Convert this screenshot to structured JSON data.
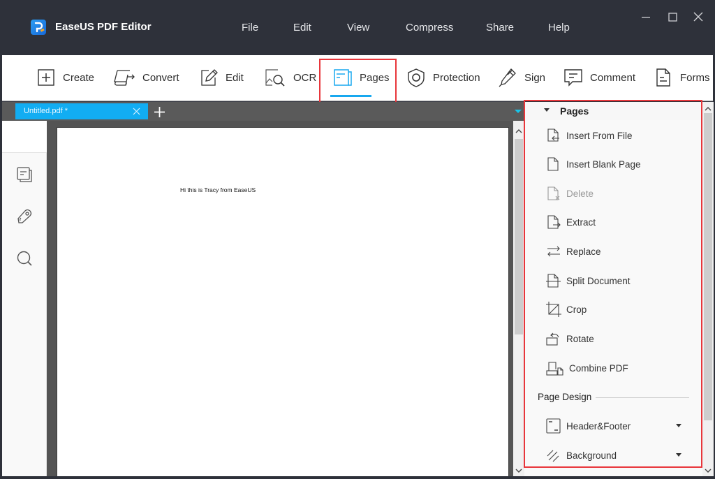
{
  "app": {
    "title": "EaseUS PDF Editor",
    "logo_icon": "easeus-pdf-logo-icon"
  },
  "menu": [
    {
      "label": "File"
    },
    {
      "label": "Edit"
    },
    {
      "label": "View"
    },
    {
      "label": "Compress"
    },
    {
      "label": "Share"
    },
    {
      "label": "Help"
    }
  ],
  "window_controls": {
    "minimize_icon": "minimize-icon",
    "maximize_icon": "maximize-icon",
    "close_icon": "close-icon"
  },
  "toolbar": {
    "active": "Pages",
    "accent_color": "#18a8ef",
    "highlight_color": "#e8363b",
    "items": [
      {
        "label": "Create",
        "icon": "plus-square-icon"
      },
      {
        "label": "Convert",
        "icon": "convert-icon"
      },
      {
        "label": "Edit",
        "icon": "pencil-edit-icon"
      },
      {
        "label": "OCR",
        "icon": "ocr-scan-icon"
      },
      {
        "label": "Pages",
        "icon": "pages-icon"
      },
      {
        "label": "Protection",
        "icon": "shield-icon"
      },
      {
        "label": "Sign",
        "icon": "pen-sign-icon"
      },
      {
        "label": "Comment",
        "icon": "comment-icon"
      },
      {
        "label": "Forms",
        "icon": "form-document-icon"
      }
    ]
  },
  "tabs": [
    {
      "label": "Untitled.pdf *",
      "active": true
    }
  ],
  "tab_color": "#12adf2",
  "side_panel": {
    "icons": [
      "thumbnails-icon",
      "tag-bookmark-icon",
      "search-icon"
    ]
  },
  "document": {
    "text": "Hi this is Tracy from EaseUS"
  },
  "pages_panel": {
    "title": "Pages",
    "items": [
      {
        "label": "Insert From File",
        "icon": "insert-from-file-icon",
        "enabled": true
      },
      {
        "label": "Insert Blank Page",
        "icon": "blank-page-icon",
        "enabled": true
      },
      {
        "label": "Delete",
        "icon": "delete-page-icon",
        "enabled": false
      },
      {
        "label": "Extract",
        "icon": "extract-page-icon",
        "enabled": true
      },
      {
        "label": "Replace",
        "icon": "replace-arrows-icon",
        "enabled": true
      },
      {
        "label": "Split Document",
        "icon": "split-document-icon",
        "enabled": true
      },
      {
        "label": "Crop",
        "icon": "crop-icon",
        "enabled": true
      },
      {
        "label": "Rotate",
        "icon": "rotate-icon",
        "enabled": true
      },
      {
        "label": "Combine PDF",
        "icon": "combine-pdf-icon",
        "enabled": true
      }
    ],
    "page_design": {
      "title": "Page Design",
      "items": [
        {
          "label": "Header&Footer",
          "icon": "header-footer-icon",
          "has_dropdown": true
        },
        {
          "label": "Background",
          "icon": "background-hatch-icon",
          "has_dropdown": true
        }
      ]
    }
  }
}
